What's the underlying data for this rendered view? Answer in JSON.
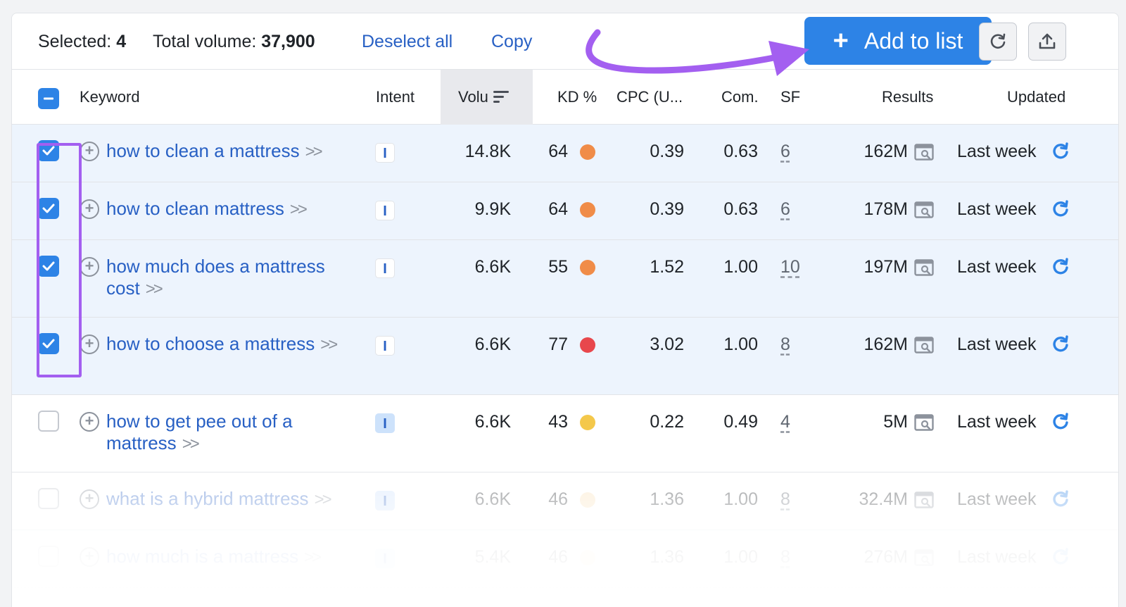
{
  "toolbar": {
    "selected_label": "Selected:",
    "selected_count": "4",
    "total_label": "Total volume:",
    "total_value": "37,900",
    "deselect_label": "Deselect all",
    "copy_label": "Copy",
    "add_label": "Add to list",
    "refresh_icon": "refresh-icon",
    "export_icon": "export-icon"
  },
  "columns": {
    "keyword": "Keyword",
    "intent": "Intent",
    "volume": "Volu",
    "kd": "KD %",
    "cpc": "CPC (U...",
    "com": "Com.",
    "sf": "SF",
    "results": "Results",
    "updated": "Updated"
  },
  "colors": {
    "accent": "#2d83e6",
    "link": "#2860c4",
    "highlight": "#a35ff0",
    "selected_row": "#edf4fd",
    "kd_orange": "#f08c48",
    "kd_red": "#e8474c",
    "kd_yellow": "#f4c84b",
    "kd_light": "#f9e0b5"
  },
  "rows": [
    {
      "keyword": "how to clean a mattress",
      "intent": "I",
      "volume": "14.8K",
      "kd": "64",
      "kd_color": "#f08c48",
      "cpc": "0.39",
      "com": "0.63",
      "sf": "6",
      "results": "162M",
      "updated": "Last week",
      "selected": true
    },
    {
      "keyword": "how to clean mattress",
      "intent": "I",
      "volume": "9.9K",
      "kd": "64",
      "kd_color": "#f08c48",
      "cpc": "0.39",
      "com": "0.63",
      "sf": "6",
      "results": "178M",
      "updated": "Last week",
      "selected": true
    },
    {
      "keyword": "how much does a mattress cost",
      "intent": "I",
      "volume": "6.6K",
      "kd": "55",
      "kd_color": "#f08c48",
      "cpc": "1.52",
      "com": "1.00",
      "sf": "10",
      "results": "197M",
      "updated": "Last week",
      "selected": true
    },
    {
      "keyword": "how to choose a mattress",
      "intent": "I",
      "volume": "6.6K",
      "kd": "77",
      "kd_color": "#e8474c",
      "cpc": "3.02",
      "com": "1.00",
      "sf": "8",
      "results": "162M",
      "updated": "Last week",
      "selected": true
    },
    {
      "keyword": "how to get pee out of a mattress",
      "intent": "I",
      "volume": "6.6K",
      "kd": "43",
      "kd_color": "#f4c84b",
      "cpc": "0.22",
      "com": "0.49",
      "sf": "4",
      "results": "5M",
      "updated": "Last week",
      "selected": false
    },
    {
      "keyword": "what is a hybrid mattress",
      "intent": "I",
      "volume": "6.6K",
      "kd": "46",
      "kd_color": "#f9e0b5",
      "cpc": "1.36",
      "com": "1.00",
      "sf": "8",
      "results": "32.4M",
      "updated": "Last week",
      "selected": false
    },
    {
      "keyword": "how much is a mattress",
      "intent": "I",
      "volume": "5.4K",
      "kd": "46",
      "kd_color": "#f9e0b5",
      "cpc": "1.36",
      "com": "1.00",
      "sf": "8",
      "results": "276M",
      "updated": "Last week",
      "selected": false
    }
  ]
}
